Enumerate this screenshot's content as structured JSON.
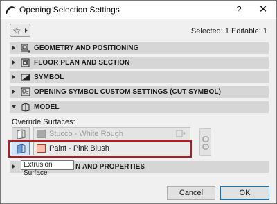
{
  "window": {
    "title": "Opening Selection Settings",
    "help_label": "?",
    "close_label": "✕"
  },
  "toolbar": {
    "selected_text": "Selected: 1 Editable: 1"
  },
  "panels": [
    {
      "label": "GEOMETRY AND POSITIONING",
      "icon": "geometry-icon",
      "expanded": false
    },
    {
      "label": "FLOOR PLAN AND SECTION",
      "icon": "floor-plan-icon",
      "expanded": false
    },
    {
      "label": "SYMBOL",
      "icon": "symbol-icon",
      "expanded": false
    },
    {
      "label": "OPENING SYMBOL CUSTOM SETTINGS (CUT SYMBOL)",
      "icon": "opening-symbol-icon",
      "expanded": false
    },
    {
      "label": "MODEL",
      "icon": "model-icon",
      "expanded": true
    },
    {
      "label": "N AND PROPERTIES",
      "icon": "",
      "expanded": false
    }
  ],
  "model": {
    "override_label": "Override Surfaces:",
    "surfaces": [
      {
        "label": "Stucco - White Rough",
        "enabled": false,
        "swatch_color": "#a8a8a8"
      },
      {
        "label": "Paint - Pink Blush",
        "enabled": true,
        "swatch_color": "#f3bfb0"
      }
    ],
    "tooltip": "Extrusion Surface"
  },
  "footer": {
    "cancel_label": "Cancel",
    "ok_label": "OK"
  },
  "colors": {
    "highlight": "#b31b22",
    "panel_bg": "#d6d6d6",
    "ok_border": "#0078d7"
  }
}
